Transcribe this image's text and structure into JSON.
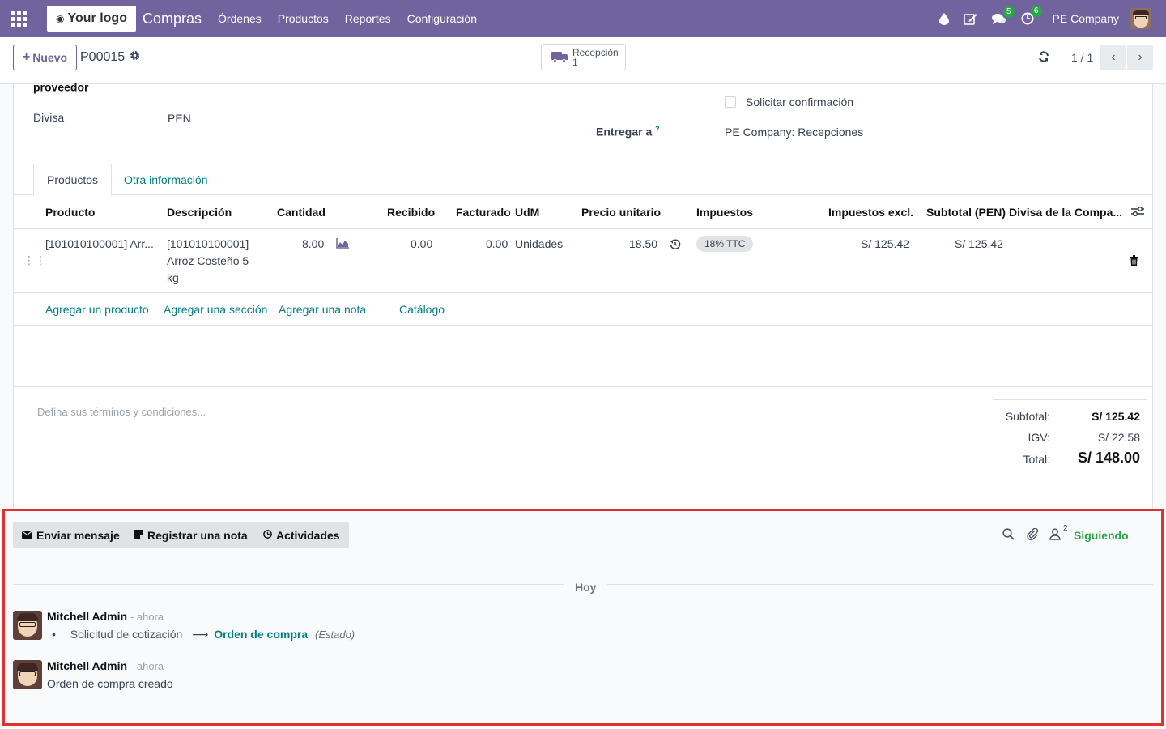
{
  "navbar": {
    "logo_text": "Your logo",
    "app_name": "Compras",
    "menu": [
      "Órdenes",
      "Productos",
      "Reportes",
      "Configuración"
    ],
    "messages_count": "5",
    "activities_count": "6",
    "company": "PE Company"
  },
  "control": {
    "new_label": "Nuevo",
    "record_name": "P00015",
    "smart_button_label": "Recepción",
    "smart_button_count": "1",
    "pager": "1 / 1"
  },
  "form": {
    "vendor_label": "proveedor",
    "currency_label": "Divisa",
    "currency_value": "PEN",
    "ask_confirmation_label": "Solicitar confirmación",
    "deliver_to_label": "Entregar a",
    "deliver_to_help": "?",
    "deliver_to_value": "PE Company: Recepciones"
  },
  "tabs": [
    "Productos",
    "Otra información"
  ],
  "table": {
    "headers": [
      "Producto",
      "Descripción",
      "Cantidad",
      "Recibido",
      "Facturado",
      "UdM",
      "Precio unitario",
      "Impuestos",
      "Impuestos excl.",
      "Subtotal (PEN)",
      "Divisa de la Compa..."
    ],
    "row": {
      "product": "[101010100001] Arr...",
      "description_1": "[101010100001]",
      "description_2": "Arroz Costeño 5",
      "description_3": "kg",
      "quantity": "8.00",
      "received": "0.00",
      "invoiced": "0.00",
      "uom": "Unidades",
      "unit_price": "18.50",
      "tax": "18% TTC",
      "tax_excluded": "S/ 125.42",
      "subtotal": "S/ 125.42"
    },
    "add_links": [
      "Agregar un producto",
      "Agregar una sección",
      "Agregar una nota",
      "Catálogo"
    ]
  },
  "terms_placeholder": "Defina sus términos y condiciones...",
  "totals": {
    "subtotal_label": "Subtotal:",
    "subtotal_value": "S/ 125.42",
    "tax_label": "IGV:",
    "tax_value": "S/ 22.58",
    "total_label": "Total:",
    "total_value": "S/ 148.00"
  },
  "chatter": {
    "send_message": "Enviar mensaje",
    "log_note": "Registrar una nota",
    "activities": "Actividades",
    "followers_count": "2",
    "following_label": "Siguiendo",
    "day_label": "Hoy",
    "messages": [
      {
        "author": "Mitchell Admin",
        "when": "- ahora",
        "old_value": "Solicitud de cotización",
        "arrow": "⟶",
        "new_value": "Orden de compra",
        "field": "(Estado)"
      },
      {
        "author": "Mitchell Admin",
        "when": "- ahora",
        "body": "Orden de compra creado"
      }
    ]
  },
  "colors": {
    "brand": "#71639e",
    "link": "#017e84",
    "following": "#28a745",
    "highlight_border": "#e03131"
  }
}
